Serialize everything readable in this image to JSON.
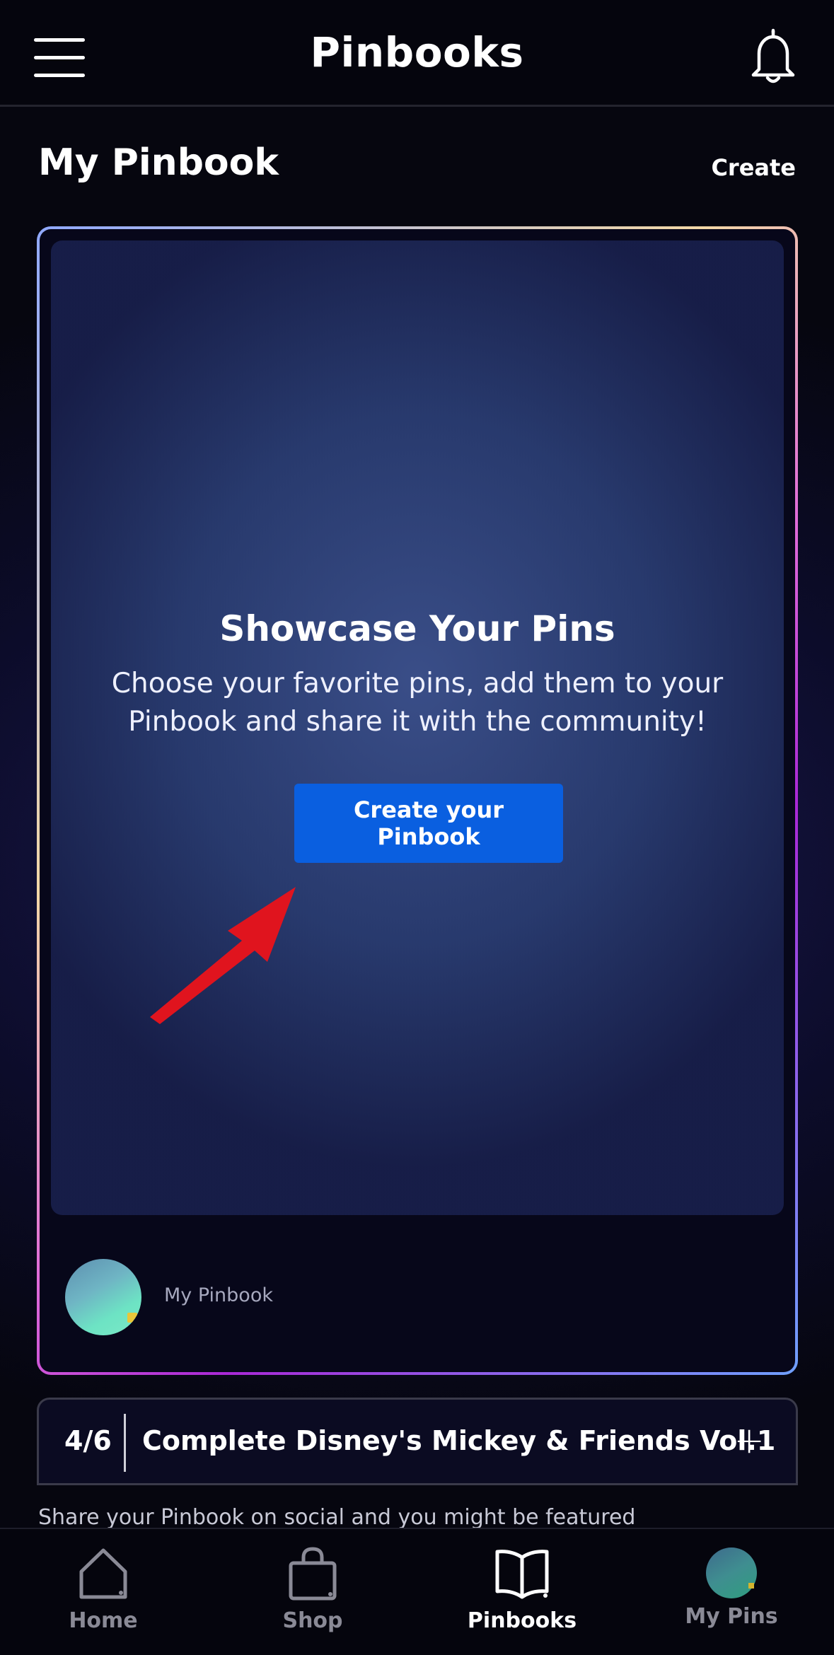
{
  "header": {
    "title": "Pinbooks"
  },
  "section": {
    "title": "My Pinbook",
    "create_label": "Create"
  },
  "card": {
    "cover_title": "Showcase Your Pins",
    "cover_desc": "Choose your favorite pins, add them to your Pinbook and share it with the community!",
    "cta_label": "Create your Pinbook",
    "owner_name": "My Pinbook"
  },
  "challenge": {
    "progress": "4/6",
    "title": "Complete Disney's Mickey & Friends Vol.1",
    "add_symbol": "+"
  },
  "feature": {
    "text": "Share your Pinbook on social and you might be featured"
  },
  "tabs": [
    {
      "label": "Home",
      "icon": "home-icon"
    },
    {
      "label": "Shop",
      "icon": "shopping-bag-icon"
    },
    {
      "label": "Pinbooks",
      "icon": "open-book-icon",
      "active": true
    },
    {
      "label": "My Pins",
      "icon": "avatar-icon"
    }
  ],
  "colors": {
    "cta": "#0a5fe0",
    "arrow": "#e0141e",
    "background": "#06060f"
  }
}
